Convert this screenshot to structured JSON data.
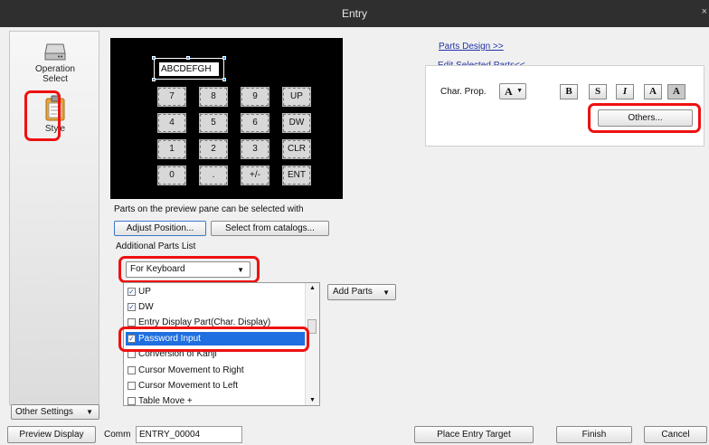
{
  "window": {
    "title": "Entry",
    "close_glyph": "×"
  },
  "sidebar": {
    "items": [
      {
        "label": "Operation Select",
        "icon": "hard-drive-icon"
      },
      {
        "label": "Style",
        "icon": "clipboard-icon",
        "selected": true
      }
    ],
    "other_settings_label": "Other Settings"
  },
  "preview": {
    "display_text": "ABCDEFGH",
    "keys": [
      "7",
      "8",
      "9",
      "UP",
      "4",
      "5",
      "6",
      "DW",
      "1",
      "2",
      "3",
      "CLR",
      "0",
      ".",
      "+/-",
      "ENT"
    ]
  },
  "parts": {
    "hint": "Parts on the preview pane can be selected with",
    "adjust_position_label": "Adjust Position...",
    "select_from_catalogs_label": "Select from catalogs...",
    "additional_parts_heading": "Additional Parts List",
    "keyboard_select_value": "For Keyboard",
    "add_parts_label": "Add Parts",
    "list_items": [
      {
        "label": "UP",
        "checked": true
      },
      {
        "label": "DW",
        "checked": true
      },
      {
        "label": "Entry Display Part(Char. Display)",
        "checked": false
      },
      {
        "label": "Password Input",
        "checked": true,
        "selected": true
      },
      {
        "label": "Conversion of Kanji",
        "checked": false
      },
      {
        "label": "Cursor Movement to Right",
        "checked": false
      },
      {
        "label": "Cursor Movement to Left",
        "checked": false
      },
      {
        "label": "Table Move +",
        "checked": false
      }
    ]
  },
  "properties": {
    "parts_design_link": "Parts Design >>",
    "edit_selected_parts_link": "Edit Selected Parts<<",
    "char_prop_label": "Char. Prop.",
    "char_prop_value": "A",
    "format_buttons": [
      "B",
      "S",
      "I",
      "A",
      "A"
    ],
    "others_label": "Others..."
  },
  "footer": {
    "preview_display_label": "Preview Display",
    "comm_label": "Comm",
    "comm_value": "ENTRY_00004",
    "place_entry_target_label": "Place Entry Target",
    "finish_label": "Finish",
    "cancel_label": "Cancel"
  },
  "colors": {
    "highlight_red": "#e11111",
    "selection_blue": "#1f6fe0",
    "link_blue": "#2233aa"
  }
}
